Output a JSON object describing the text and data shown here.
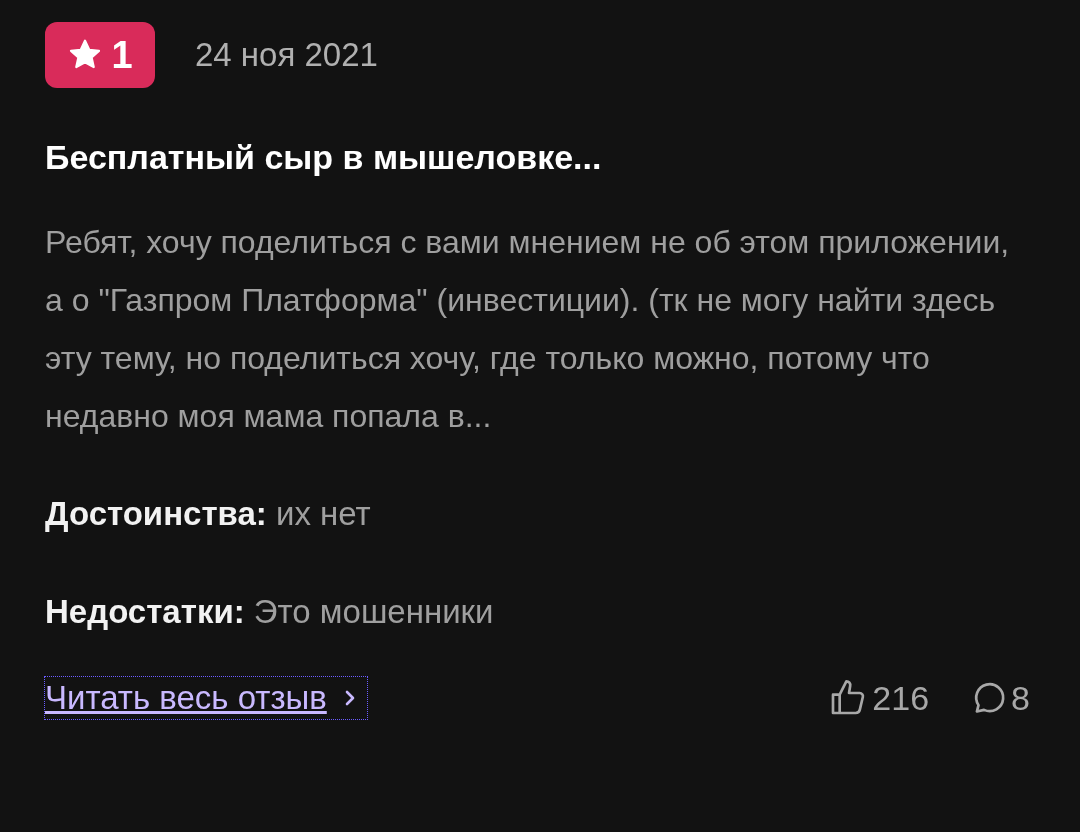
{
  "review": {
    "rating": "1",
    "date": "24 ноя 2021",
    "title": "Бесплатный сыр в мышеловке...",
    "text": "Ребят, хочу поделиться с вами мнением не об этом приложении, а о \"Газпром Платформа\" (инвестиции). (тк не могу найти здесь эту тему, но поделиться хочу, где только можно, потому что недавно моя мама попала в...",
    "details": [
      {
        "label": "Достоинства:",
        "value": "их нет"
      },
      {
        "label": "Недостатки:",
        "value": "Это мошенники"
      }
    ],
    "read_more": {
      "label": "Читать весь отзыв",
      "focused": true
    },
    "likes": "216",
    "comments": "8"
  }
}
